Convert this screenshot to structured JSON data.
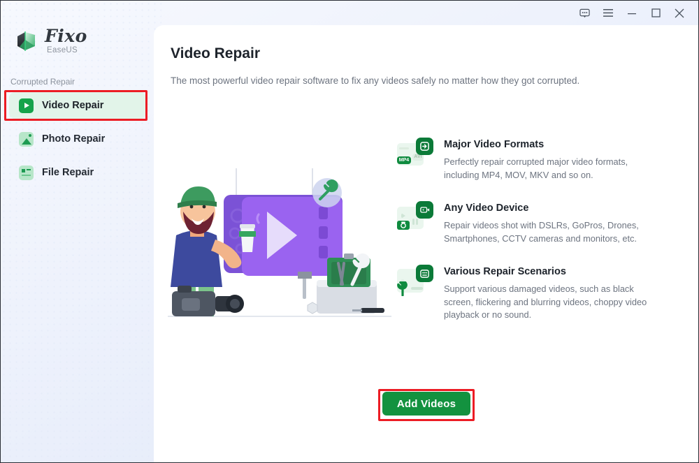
{
  "window": {
    "controls": [
      {
        "name": "feedback-icon",
        "label": "Feedback"
      },
      {
        "name": "menu-icon",
        "label": "Menu"
      },
      {
        "name": "minimize-icon",
        "label": "Minimize"
      },
      {
        "name": "maximize-icon",
        "label": "Maximize"
      },
      {
        "name": "close-icon",
        "label": "Close"
      }
    ]
  },
  "brand": {
    "name": "Fixo",
    "vendor": "EaseUS",
    "logo_icon": "fixo-cube-logo"
  },
  "sidebar": {
    "section_label": "Corrupted Repair",
    "items": [
      {
        "label": "Video Repair",
        "icon": "video-play-icon",
        "active": true
      },
      {
        "label": "Photo Repair",
        "icon": "photo-image-icon",
        "active": false
      },
      {
        "label": "File Repair",
        "icon": "file-document-icon",
        "active": false
      }
    ]
  },
  "main": {
    "title": "Video Repair",
    "subtitle": "The most powerful video repair software to fix any videos safely no matter how they got corrupted.",
    "illustration": "video-repair-technician-illustration",
    "features": [
      {
        "icon": "video-formats-icon",
        "title": "Major Video Formats",
        "description": "Perfectly repair corrupted major video formats, including MP4, MOV, MKV and so on.",
        "chips": [
          "MP4",
          "AVI"
        ]
      },
      {
        "icon": "video-device-icon",
        "title": "Any Video Device",
        "description": "Repair videos shot with DSLRs, GoPros, Drones, Smartphones, CCTV cameras and monitors, etc."
      },
      {
        "icon": "repair-scenarios-icon",
        "title": "Various Repair Scenarios",
        "description": "Support various damaged videos, such as black screen, flickering and blurring videos, choppy video playback or no sound."
      }
    ],
    "primary_action": "Add Videos"
  },
  "annotations": [
    {
      "name": "sidebar-highlight",
      "target": "Video Repair"
    },
    {
      "name": "button-highlight",
      "target": "Add Videos"
    }
  ],
  "colors": {
    "brand_green": "#13923f",
    "active_nav_bg": "#e2f4e9",
    "annotation_red": "#ec1c24",
    "panel_bg": "#ffffff",
    "app_bg": "#eef2fc"
  }
}
